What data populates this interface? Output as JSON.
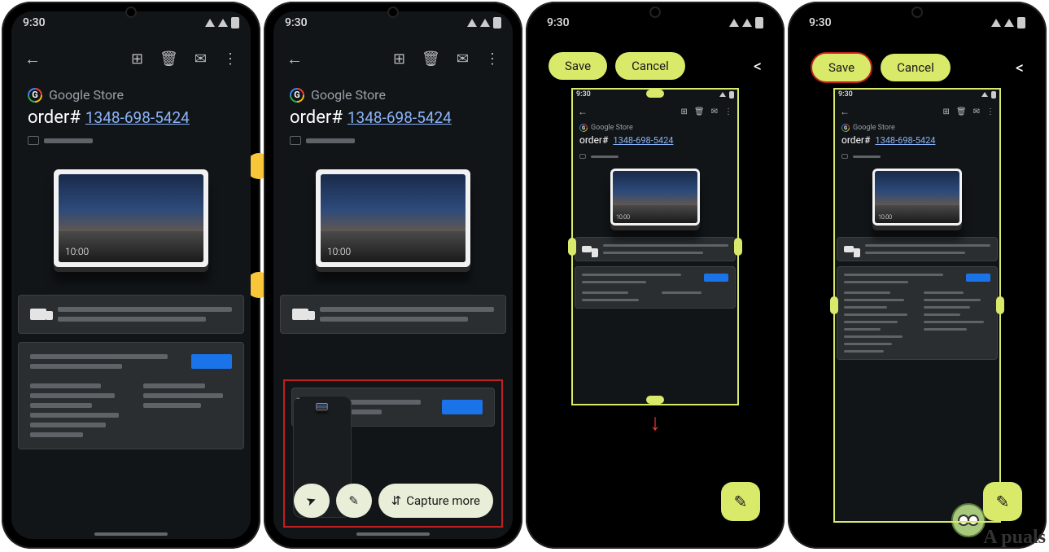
{
  "status": {
    "time": "9:30"
  },
  "email": {
    "store": "Google Store",
    "order_label": "order#",
    "order_number": "1348-698-5424",
    "tablet_time": "10:00"
  },
  "icons": {
    "back": "←",
    "archive": "⊞",
    "delete": "🗑",
    "mail": "✉",
    "more": "⋮",
    "share": "➤",
    "edit": "✎",
    "expand": "⇵"
  },
  "screenshot_actions": {
    "share": "Share",
    "edit": "Edit",
    "capture_more": "Capture more"
  },
  "crop_actions": {
    "save": "Save",
    "cancel": "Cancel"
  },
  "watermark": "A   puals"
}
